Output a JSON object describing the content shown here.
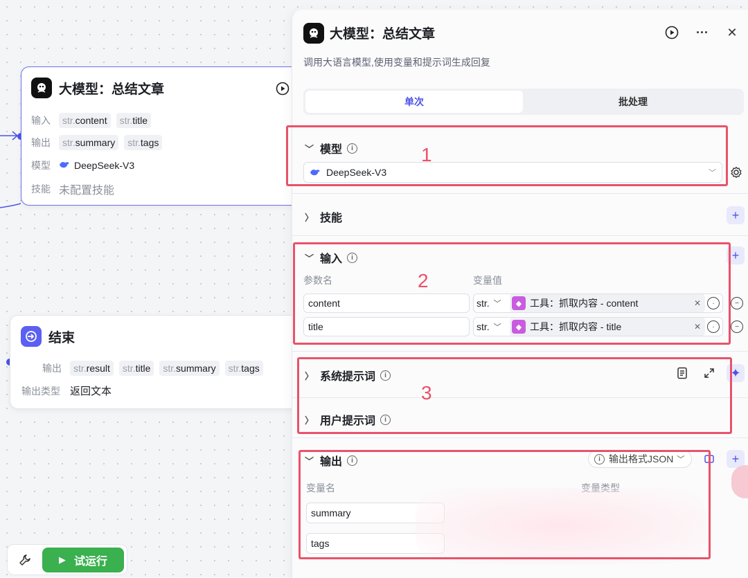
{
  "canvas": {
    "llm_node": {
      "title": "大模型：总结文章",
      "input_label": "输入",
      "inputs": [
        {
          "type": "str.",
          "name": "content"
        },
        {
          "type": "str.",
          "name": "title"
        }
      ],
      "output_label": "输出",
      "outputs": [
        {
          "type": "str.",
          "name": "summary"
        },
        {
          "type": "str.",
          "name": "tags"
        }
      ],
      "model_label": "模型",
      "model_value": "DeepSeek-V3",
      "skill_label": "技能",
      "skill_value": "未配置技能"
    },
    "end_node": {
      "title": "结束",
      "output_label": "输出",
      "outputs": [
        {
          "type": "str.",
          "name": "result"
        },
        {
          "type": "str.",
          "name": "title"
        },
        {
          "type": "str.",
          "name": "summary"
        },
        {
          "type": "str.",
          "name": "tags"
        }
      ],
      "output_type_label": "输出类型",
      "output_type_value": "返回文本"
    },
    "toolbar": {
      "run_label": "试运行"
    }
  },
  "panel": {
    "title": "大模型：总结文章",
    "description": "调用大语言模型,使用变量和提示词生成回复",
    "tabs": [
      "单次",
      "批处理"
    ],
    "model_section": {
      "title": "模型",
      "selected_model": "DeepSeek-V3"
    },
    "skill_section": {
      "title": "技能"
    },
    "input_section": {
      "title": "输入",
      "col_param": "参数名",
      "col_value": "变量值",
      "rows": [
        {
          "name": "content",
          "type": "str.",
          "value": "工具：抓取内容 - content"
        },
        {
          "name": "title",
          "type": "str.",
          "value": "工具：抓取内容 - title"
        }
      ]
    },
    "system_prompt": {
      "title": "系统提示词"
    },
    "user_prompt": {
      "title": "用户提示词"
    },
    "output_section": {
      "title": "输出",
      "format_label": "输出格式JSON",
      "col_name": "变量名",
      "col_type": "变量类型",
      "rows": [
        {
          "name": "summary"
        },
        {
          "name": "tags"
        }
      ]
    }
  },
  "annotations": [
    "1",
    "2",
    "3"
  ],
  "colors": {
    "accent": "#4d53e8",
    "annotation": "#e9526a",
    "run_button": "#3ab04f"
  }
}
